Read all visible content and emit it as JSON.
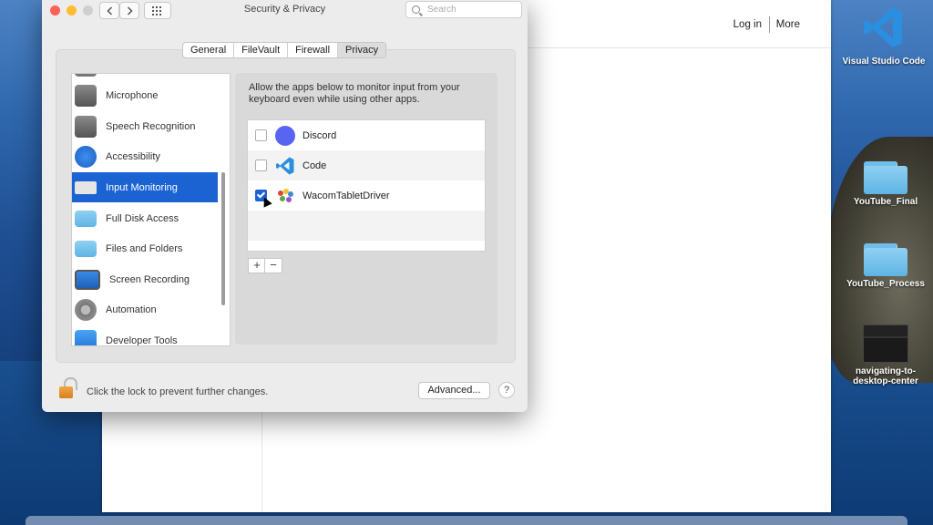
{
  "window": {
    "title": "Security & Privacy"
  },
  "search": {
    "placeholder": "Search"
  },
  "tabs": [
    {
      "label": "General"
    },
    {
      "label": "FileVault"
    },
    {
      "label": "Firewall"
    },
    {
      "label": "Privacy",
      "active": true
    }
  ],
  "sidebar": {
    "items": [
      {
        "label": "Microphone",
        "icon": "microphone-icon"
      },
      {
        "label": "Speech Recognition",
        "icon": "speech-recognition-icon"
      },
      {
        "label": "Accessibility",
        "icon": "accessibility-icon"
      },
      {
        "label": "Input Monitoring",
        "icon": "keyboard-icon",
        "selected": true
      },
      {
        "label": "Full Disk Access",
        "icon": "folder-icon"
      },
      {
        "label": "Files and Folders",
        "icon": "folder-icon"
      },
      {
        "label": "Screen Recording",
        "icon": "display-icon"
      },
      {
        "label": "Automation",
        "icon": "gear-icon"
      },
      {
        "label": "Developer Tools",
        "icon": "developer-tools-icon"
      }
    ]
  },
  "content": {
    "description": "Allow the apps below to monitor input from your keyboard even while using other apps.",
    "apps": [
      {
        "name": "Discord",
        "checked": false,
        "icon": "discord-icon"
      },
      {
        "name": "Code",
        "checked": false,
        "icon": "vscode-icon"
      },
      {
        "name": "WacomTabletDriver",
        "checked": true,
        "icon": "wacom-icon"
      }
    ],
    "add_label": "+",
    "remove_label": "−"
  },
  "footer": {
    "lock_text": "Click the lock to prevent further changes.",
    "advanced_label": "Advanced...",
    "help_label": "?"
  },
  "browser": {
    "login_label": "Log in",
    "more_label": "More"
  },
  "desktop_icons": [
    {
      "label": "Visual Studio Code"
    },
    {
      "label": "YouTube_Final"
    },
    {
      "label": "YouTube_Process"
    },
    {
      "label": "navigating-to-desktop-center"
    }
  ],
  "colors": {
    "selection": "#1b63d3",
    "close": "#ff5f57",
    "minimize": "#febc2e",
    "zoom": "#cfcfcf"
  }
}
